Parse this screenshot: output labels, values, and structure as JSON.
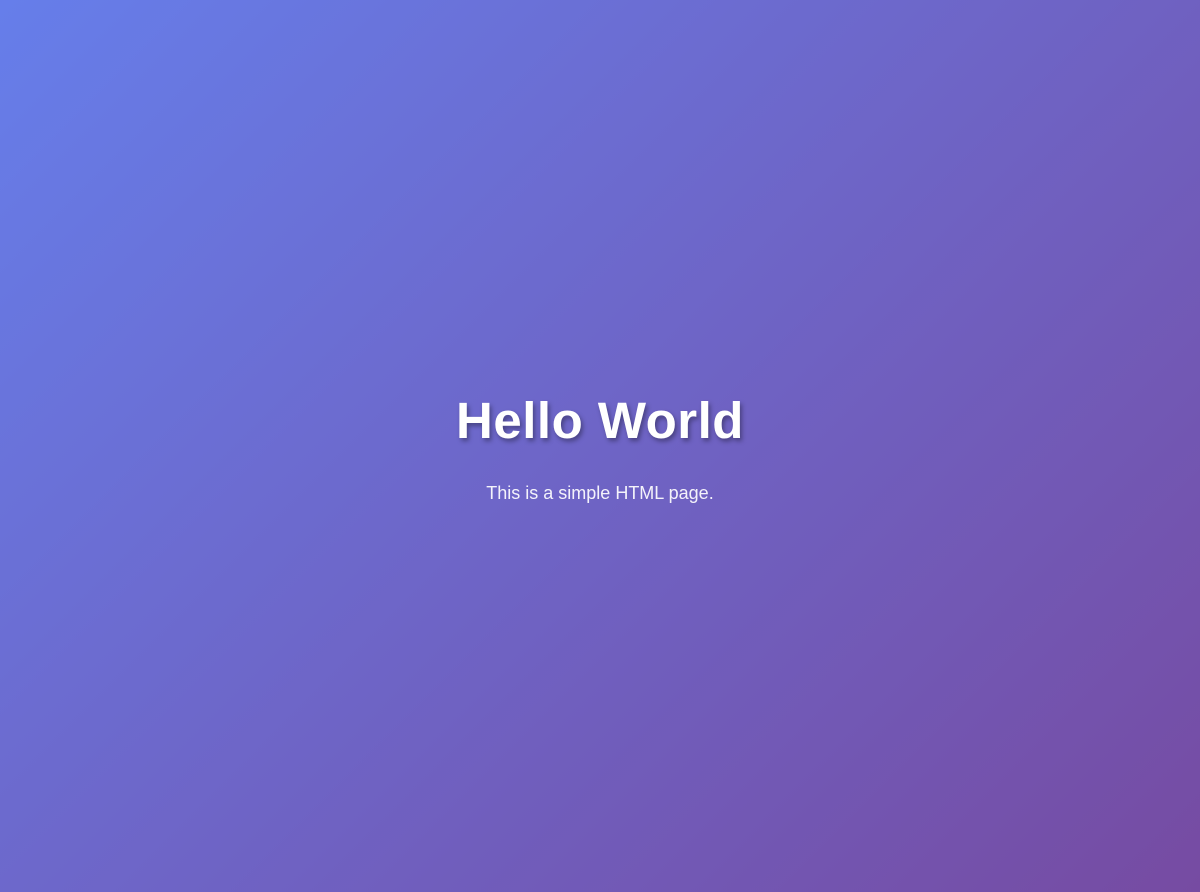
{
  "colors": {
    "gradient_start": "#667eea",
    "gradient_end": "#764ba2",
    "text": "#ffffff"
  },
  "hero": {
    "title": "Hello World",
    "subtitle": "This is a simple HTML page."
  }
}
